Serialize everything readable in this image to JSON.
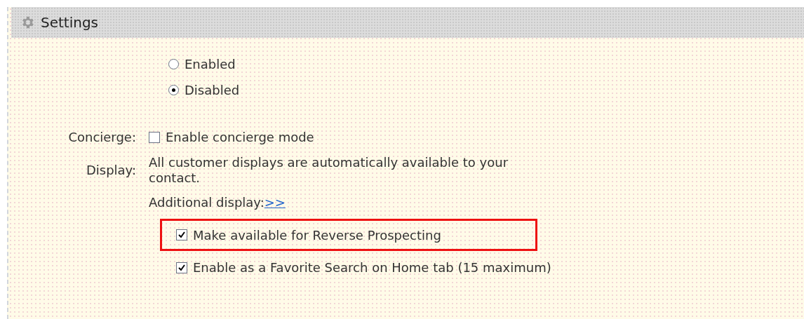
{
  "panel": {
    "title": "Settings"
  },
  "status_options": [
    {
      "label": "Enabled",
      "selected": false
    },
    {
      "label": "Disabled",
      "selected": true
    }
  ],
  "concierge": {
    "label": "Concierge:",
    "option": "Enable concierge mode",
    "checked": false
  },
  "display": {
    "label": "Display:",
    "description": "All customer displays are automatically available to your contact.",
    "additional_label": "Additional display:",
    "additional_link": ">>"
  },
  "options": [
    {
      "label": "Make available for Reverse Prospecting",
      "checked": true,
      "highlighted": true
    },
    {
      "label": "Enable as a Favorite Search on Home tab (15 maximum)",
      "checked": true,
      "highlighted": false
    }
  ]
}
